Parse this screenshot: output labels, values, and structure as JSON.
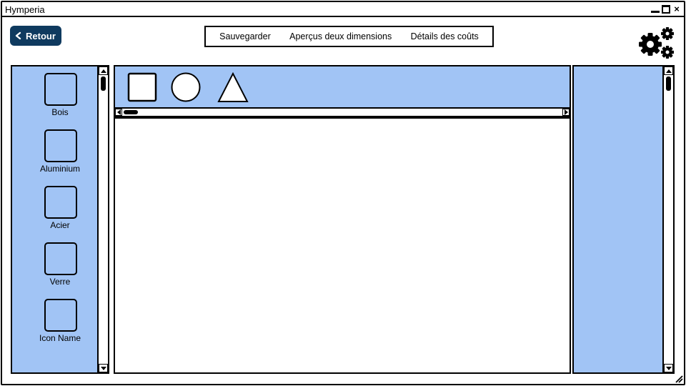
{
  "window": {
    "title": "Hymperia"
  },
  "toolbar": {
    "back_label": "Retour",
    "menu": [
      {
        "label": "Sauvegarder"
      },
      {
        "label": "Aperçus deux dimensions"
      },
      {
        "label": "Détails des coûts"
      }
    ]
  },
  "materials": [
    {
      "label": "Bois"
    },
    {
      "label": "Aluminium"
    },
    {
      "label": "Acier"
    },
    {
      "label": "Verre"
    },
    {
      "label": "Icon Name"
    }
  ],
  "shapes": [
    {
      "icon": "square-shape-icon"
    },
    {
      "icon": "circle-shape-icon"
    },
    {
      "icon": "triangle-shape-icon"
    }
  ],
  "colors": {
    "panel_blue": "#a1c4f5",
    "back_button": "#0f3a5f"
  }
}
